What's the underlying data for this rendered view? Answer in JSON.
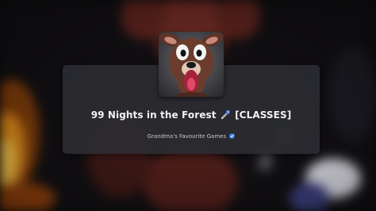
{
  "experience": {
    "title": "99 Nights in the Forest",
    "title_suffix": "[CLASSES]",
    "title_icon": "torch-icon",
    "creator": "Grandma's Favourite Games",
    "creator_badge_icon": "verified-badge-icon"
  },
  "colors": {
    "card_background": "#2c2d32",
    "title_text": "#f2f2f2",
    "creator_text": "#c9c9cc",
    "verified_badge": "#3b82f6"
  }
}
